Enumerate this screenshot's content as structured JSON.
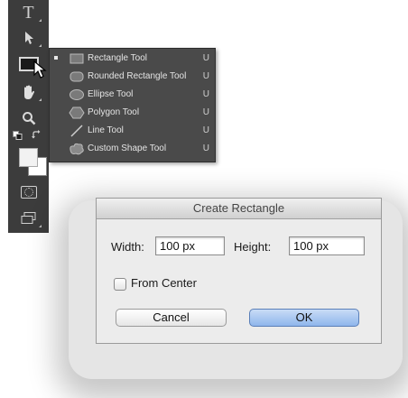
{
  "toolbar": {
    "type_tool_glyph": "T",
    "tools": [
      "type-tool",
      "path-selection-tool",
      "rectangle-tool",
      "hand-tool",
      "zoom-tool",
      "default-colors",
      "quick-mask",
      "screen-mode"
    ]
  },
  "flyout": {
    "items": [
      {
        "label": "Rectangle Tool",
        "key": "U",
        "icon": "rectangle-icon",
        "selected": true
      },
      {
        "label": "Rounded Rectangle Tool",
        "key": "U",
        "icon": "rounded-rectangle-icon",
        "selected": false
      },
      {
        "label": "Ellipse Tool",
        "key": "U",
        "icon": "ellipse-icon",
        "selected": false
      },
      {
        "label": "Polygon Tool",
        "key": "U",
        "icon": "polygon-icon",
        "selected": false
      },
      {
        "label": "Line Tool",
        "key": "U",
        "icon": "line-icon",
        "selected": false
      },
      {
        "label": "Custom Shape Tool",
        "key": "U",
        "icon": "custom-shape-icon",
        "selected": false
      }
    ]
  },
  "dialog": {
    "title": "Create Rectangle",
    "width_label": "Width:",
    "width_value": "100 px",
    "height_label": "Height:",
    "height_value": "100 px",
    "from_center_label": "From Center",
    "from_center_checked": false,
    "cancel_label": "Cancel",
    "ok_label": "OK"
  },
  "colors": {
    "toolbar_bg": "#3c3c3c",
    "flyout_bg": "#4a4a4a",
    "dialog_bg": "#ececec",
    "ok_button": "#8fb6ec"
  }
}
